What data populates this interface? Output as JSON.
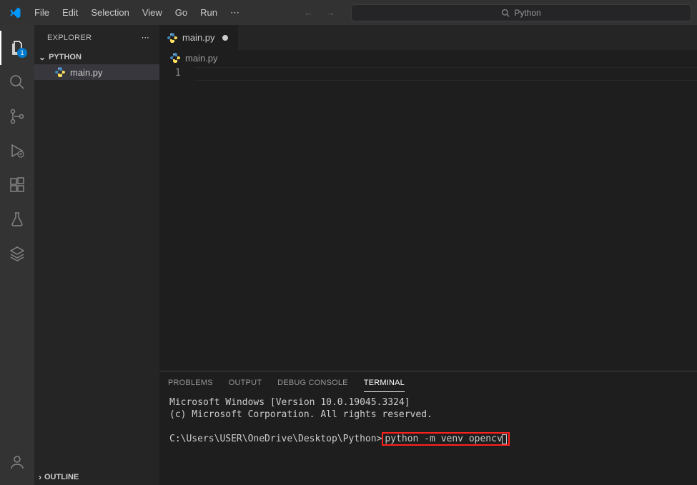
{
  "menubar": {
    "items": [
      "File",
      "Edit",
      "Selection",
      "View",
      "Go",
      "Run"
    ]
  },
  "search_placeholder": "Python",
  "activitybar": {
    "explorer_badge": "1"
  },
  "sidebar": {
    "title": "EXPLORER",
    "folder": "PYTHON",
    "files": [
      {
        "name": "main.py"
      }
    ],
    "outline_label": "OUTLINE"
  },
  "tabs": [
    {
      "label": "main.py",
      "dirty": true
    }
  ],
  "breadcrumb": "main.py",
  "editor": {
    "line_numbers": [
      "1"
    ]
  },
  "panel": {
    "tabs": [
      "PROBLEMS",
      "OUTPUT",
      "DEBUG CONSOLE",
      "TERMINAL"
    ],
    "active_tab": "TERMINAL"
  },
  "terminal": {
    "line1": "Microsoft Windows [Version 10.0.19045.3324]",
    "line2": "(c) Microsoft Corporation. All rights reserved.",
    "prompt": "C:\\Users\\USER\\OneDrive\\Desktop\\Python>",
    "command": "python -m venv opencv"
  }
}
